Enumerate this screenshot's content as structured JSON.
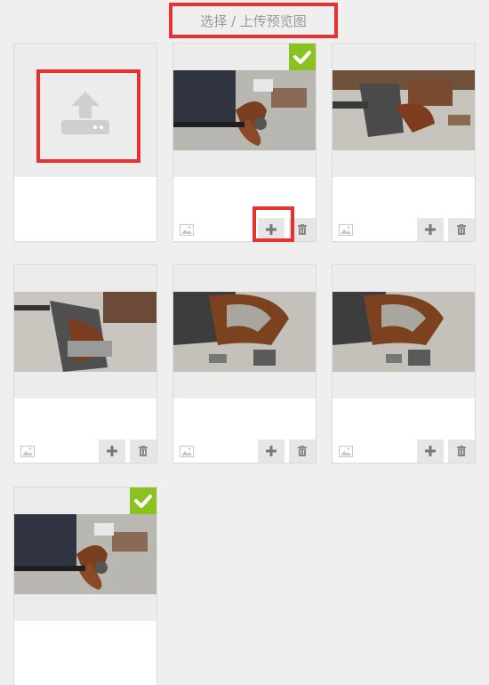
{
  "header": {
    "title": "选择 / 上传预览图"
  },
  "cards": [
    {
      "id": "upload",
      "icon": "upload-icon"
    },
    {
      "id": "1",
      "selected": true
    },
    {
      "id": "2",
      "selected": false
    },
    {
      "id": "3",
      "selected": false
    },
    {
      "id": "4",
      "selected": false
    },
    {
      "id": "5",
      "selected": false
    },
    {
      "id": "6",
      "selected": true
    }
  ],
  "icons": {
    "check": "check-icon",
    "image": "image-icon",
    "add": "plus-icon",
    "delete": "trash-icon"
  },
  "colors": {
    "highlight": "#e83232",
    "selected": "#8ac220",
    "background": "#efefef"
  }
}
